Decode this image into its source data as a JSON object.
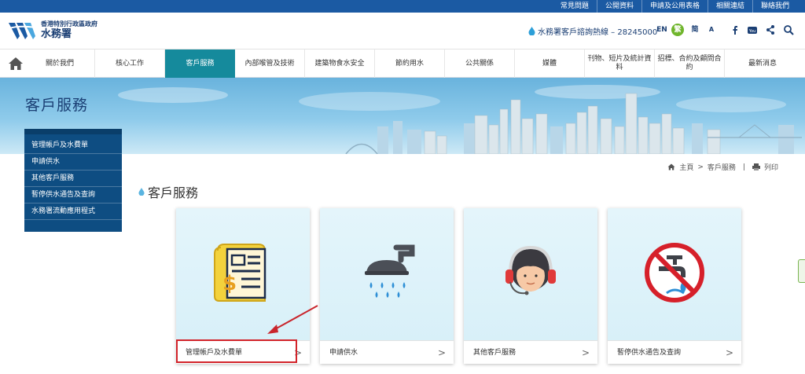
{
  "topbar": {
    "links": [
      "常見問題",
      "公開資料",
      "申請及公用表格",
      "相關連結",
      "聯絡我們"
    ]
  },
  "header": {
    "org_line1": "香港特別行政區政府",
    "org_line2": "水務署",
    "hotline": "水務署客戶諮詢熱線 – 28245000",
    "lang_en": "EN",
    "lang_tc": "繁",
    "lang_sc": "简",
    "font_size": "A"
  },
  "nav": {
    "items": [
      "關於我們",
      "核心工作",
      "客戶服務",
      "內部喉管及技術",
      "建築物食水安全",
      "節約用水",
      "公共關係",
      "媒體",
      "刊物、短片及統計資料",
      "招標、合約及顧問合約",
      "最新消息"
    ],
    "active_index": 2
  },
  "banner": {
    "title": "客戶服務"
  },
  "sidemenu": {
    "items": [
      "管理帳戶及水費單",
      "申請供水",
      "其他客戶服務",
      "暫停供水通告及查詢",
      "水務署流動應用程式"
    ]
  },
  "breadcrumb": {
    "home": "主頁",
    "sep": ">",
    "current": "客戶服務",
    "divider": "|",
    "print": "列印"
  },
  "main": {
    "title": "客戶服務",
    "cards": [
      {
        "label": "管理帳戶及水費單",
        "icon": "bill-document-icon"
      },
      {
        "label": "申請供水",
        "icon": "shower-icon"
      },
      {
        "label": "其他客戶服務",
        "icon": "customer-service-agent-icon"
      },
      {
        "label": "暫停供水通告及查詢",
        "icon": "no-water-tap-icon"
      }
    ],
    "chevron": ">"
  },
  "colors": {
    "topbar": "#1b5aa3",
    "nav_active": "#158a9c",
    "sidemenu": "#0e4d82",
    "highlight": "#d2232a"
  }
}
